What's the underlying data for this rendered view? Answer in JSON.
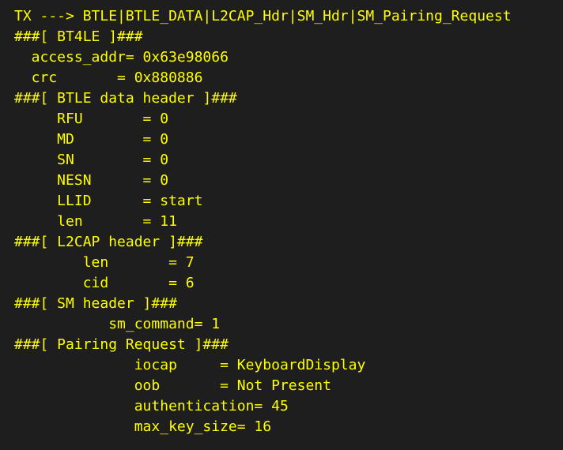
{
  "terminal": {
    "text_color": "#ffff00",
    "background_color": "#1e1e1e",
    "lines": [
      "TX ---> BTLE|BTLE_DATA|L2CAP_Hdr|SM_Hdr|SM_Pairing_Request",
      "###[ BT4LE ]###",
      "  access_addr= 0x63e98066",
      "  crc       = 0x880886",
      "###[ BTLE data header ]###",
      "     RFU       = 0",
      "     MD        = 0",
      "     SN        = 0",
      "     NESN      = 0",
      "     LLID      = start",
      "     len       = 11",
      "###[ L2CAP header ]###",
      "        len       = 7",
      "        cid       = 6",
      "###[ SM header ]###",
      "           sm_command= 1",
      "###[ Pairing Request ]###",
      "              iocap     = KeyboardDisplay",
      "              oob       = Not Present",
      "              authentication= 45",
      "              max_key_size= 16"
    ]
  }
}
